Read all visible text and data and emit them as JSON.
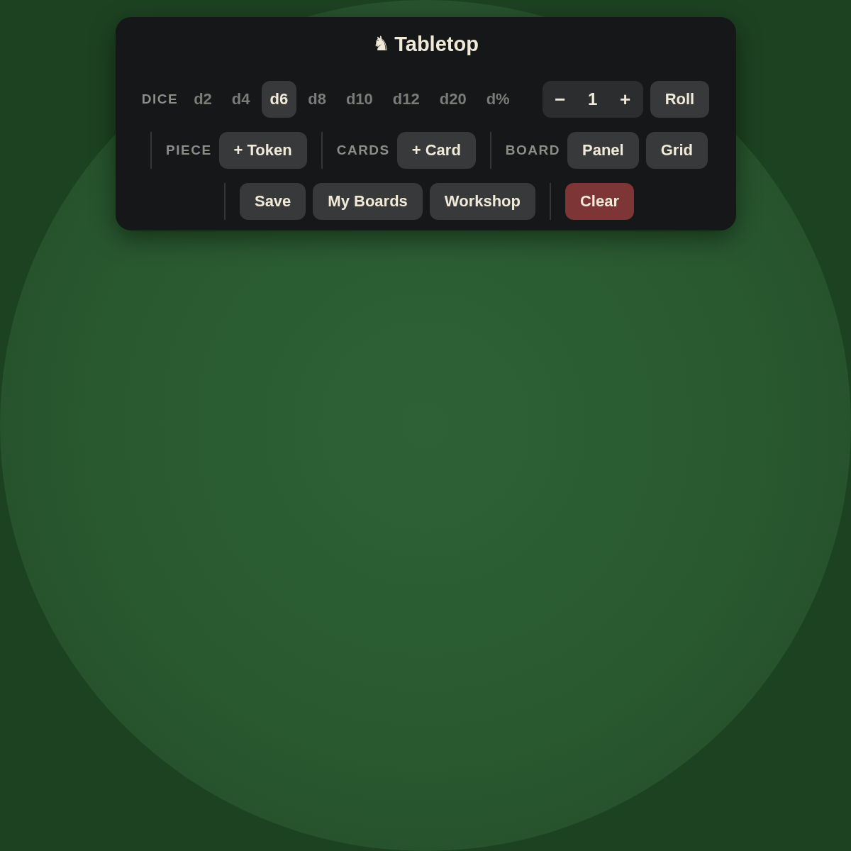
{
  "title": {
    "icon": "♞",
    "text": "Tabletop"
  },
  "dice": {
    "label": "DICE",
    "options": [
      {
        "label": "d2",
        "selected": false
      },
      {
        "label": "d4",
        "selected": false
      },
      {
        "label": "d6",
        "selected": true
      },
      {
        "label": "d8",
        "selected": false
      },
      {
        "label": "d10",
        "selected": false
      },
      {
        "label": "d12",
        "selected": false
      },
      {
        "label": "d20",
        "selected": false
      },
      {
        "label": "d%",
        "selected": false
      }
    ],
    "count": {
      "decrement": "−",
      "value": "1",
      "increment": "+"
    },
    "roll_button": "Roll"
  },
  "tools": [
    {
      "label": "PIECE",
      "buttons": [
        {
          "label": "+ Token"
        }
      ]
    },
    {
      "label": "CARDS",
      "buttons": [
        {
          "label": "+ Card"
        }
      ]
    },
    {
      "label": "BOARD",
      "buttons": [
        {
          "label": "Panel"
        },
        {
          "label": "Grid"
        }
      ]
    }
  ],
  "actions": [
    {
      "buttons": [
        {
          "label": "Save",
          "kind": "default"
        },
        {
          "label": "My Boards",
          "kind": "default"
        },
        {
          "label": "Workshop",
          "kind": "default"
        }
      ]
    },
    {
      "buttons": [
        {
          "label": "Clear",
          "kind": "danger"
        }
      ]
    }
  ]
}
